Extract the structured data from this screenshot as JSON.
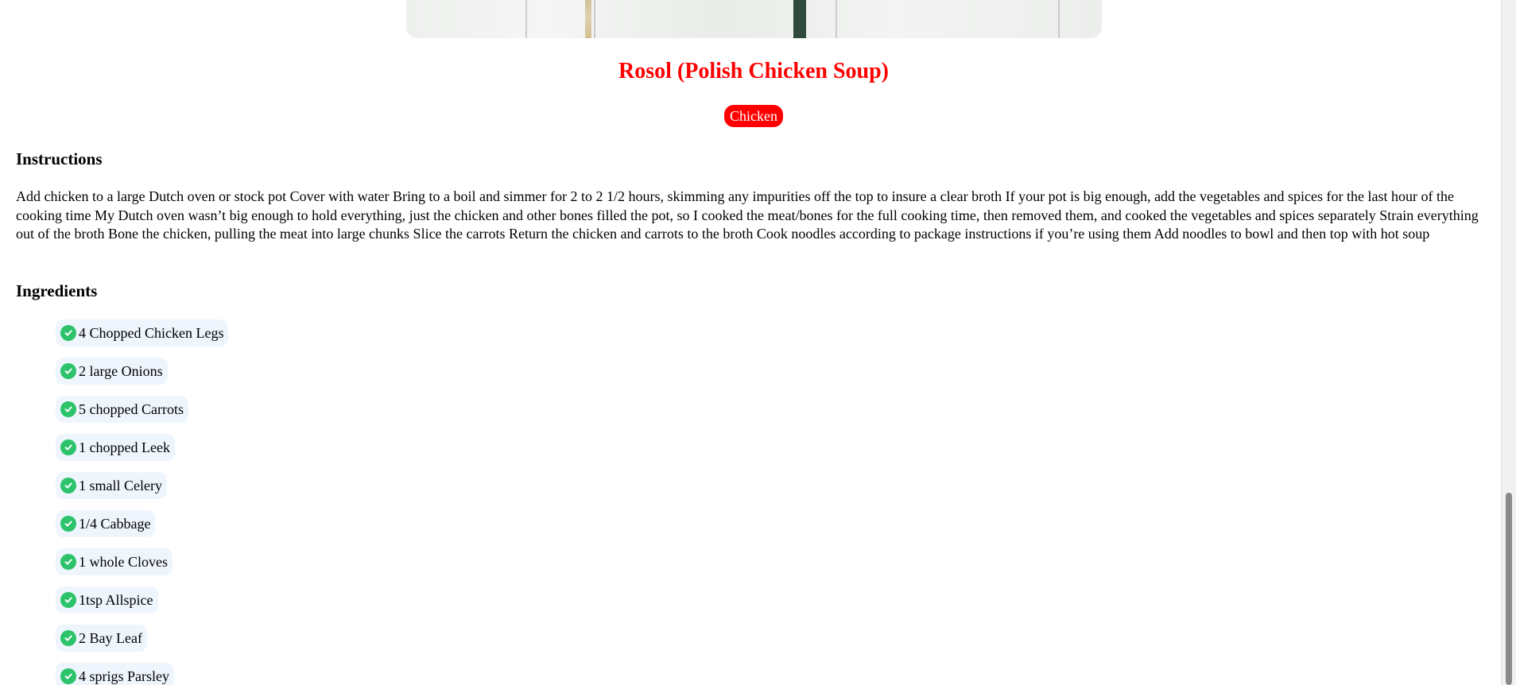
{
  "recipe": {
    "title": "Rosol (Polish Chicken Soup)",
    "category_tag": "Chicken",
    "instructions_heading": "Instructions",
    "instructions_text": "Add chicken to a large Dutch oven or stock pot Cover with water Bring to a boil and simmer for 2 to 2 1/2 hours, skimming any impurities off the top to insure a clear broth If your pot is big enough, add the vegetables and spices for the last hour of the cooking time My Dutch oven wasn’t big enough to hold everything, just the chicken and other bones filled the pot, so I cooked the meat/bones for the full cooking time, then removed them, and cooked the vegetables and spices separately Strain everything out of the broth Bone the chicken, pulling the meat into large chunks Slice the carrots Return the chicken and carrots to the broth Cook noodles according to package instructions if you’re using them Add noodles to bowl and then top with hot soup",
    "ingredients_heading": "Ingredients",
    "ingredients": [
      "4 Chopped Chicken Legs",
      "2 large Onions",
      "5 chopped Carrots",
      "1 chopped Leek",
      "1 small Celery",
      "1/4 Cabbage",
      "1 whole Cloves",
      "1tsp Allspice",
      "2 Bay Leaf",
      "4 sprigs Parsley"
    ]
  },
  "colors": {
    "title": "#ff0000",
    "tag_background": "#ff0000",
    "check_icon": "#2cc36b",
    "ingredient_pill_background": "#eef5fc"
  },
  "icons": {
    "ingredient_marker": "check-circle-icon"
  }
}
